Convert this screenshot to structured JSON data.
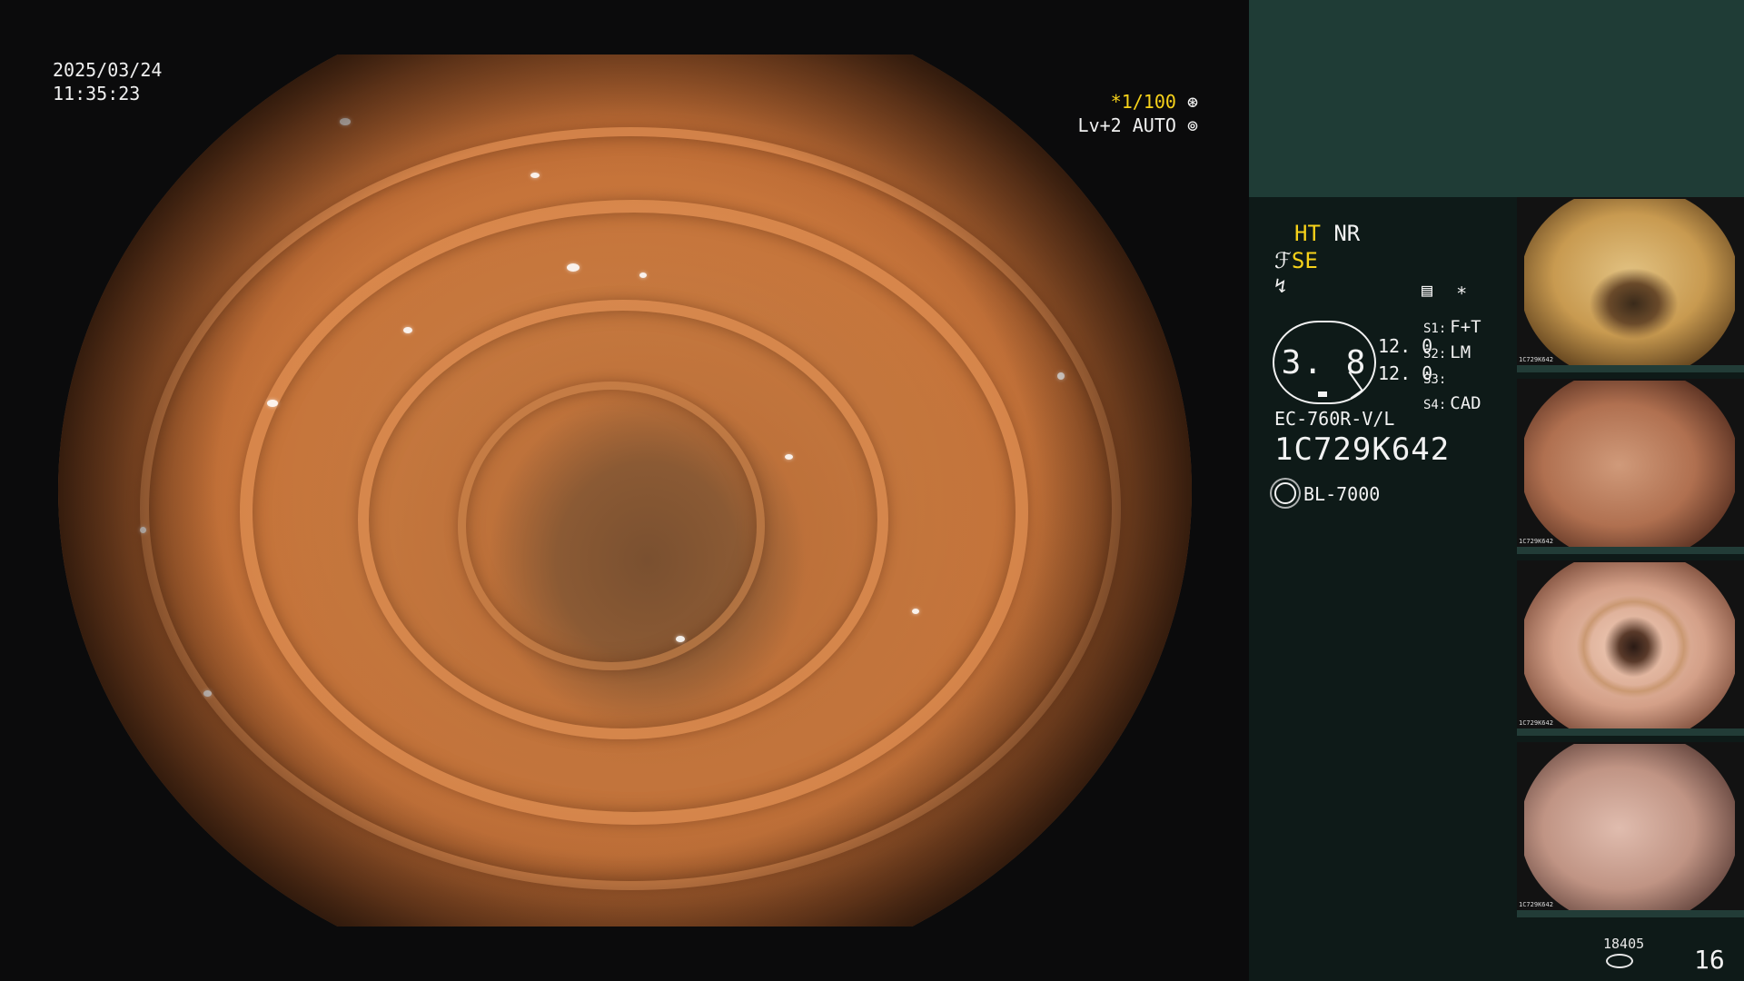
{
  "overlay": {
    "date": "2025/03/24",
    "time": "11:35:23",
    "shutter_prefix": "*1/100",
    "shutter_icon": "aperture-icon",
    "mode": "Lv+2 AUTO",
    "mode_icon": "iris-icon"
  },
  "panel": {
    "ht": "HT",
    "nr": "NR",
    "se_prefix": "ℱ",
    "se": "SE",
    "wave_icon": "↯",
    "menu_icon": "▤",
    "asterisk": "∗",
    "gauge_value": "3. 8",
    "val_1": "12. 0",
    "val_2": "12. 0",
    "switches": [
      {
        "label": "S1:",
        "value": "F+T"
      },
      {
        "label": "S2:",
        "value": "LM"
      },
      {
        "label": "S3:",
        "value": ""
      },
      {
        "label": "S4:",
        "value": "CAD"
      }
    ],
    "scope_model": "EC-760R-V/L",
    "scope_serial": "1C729K642",
    "light_source": "BL-7000"
  },
  "thumbnails": [
    {
      "label": "1C729K642",
      "color_center": "#d9b070",
      "color_edge": "#7a5a2a",
      "lumen": "#3a2a1a"
    },
    {
      "label": "1C729K642",
      "color_center": "#c98a6a",
      "color_edge": "#6e4030",
      "lumen": ""
    },
    {
      "label": "1C729K642",
      "color_center": "#e8c0a8",
      "color_edge": "#8a5a48",
      "lumen": "#2a1a14"
    },
    {
      "label": "1C729K642",
      "color_center": "#d8b0a0",
      "color_edge": "#7a5850",
      "lumen": ""
    }
  ],
  "footer": {
    "storage_count": "18405",
    "storage_icon": "disk-icon",
    "image_count": "16"
  }
}
